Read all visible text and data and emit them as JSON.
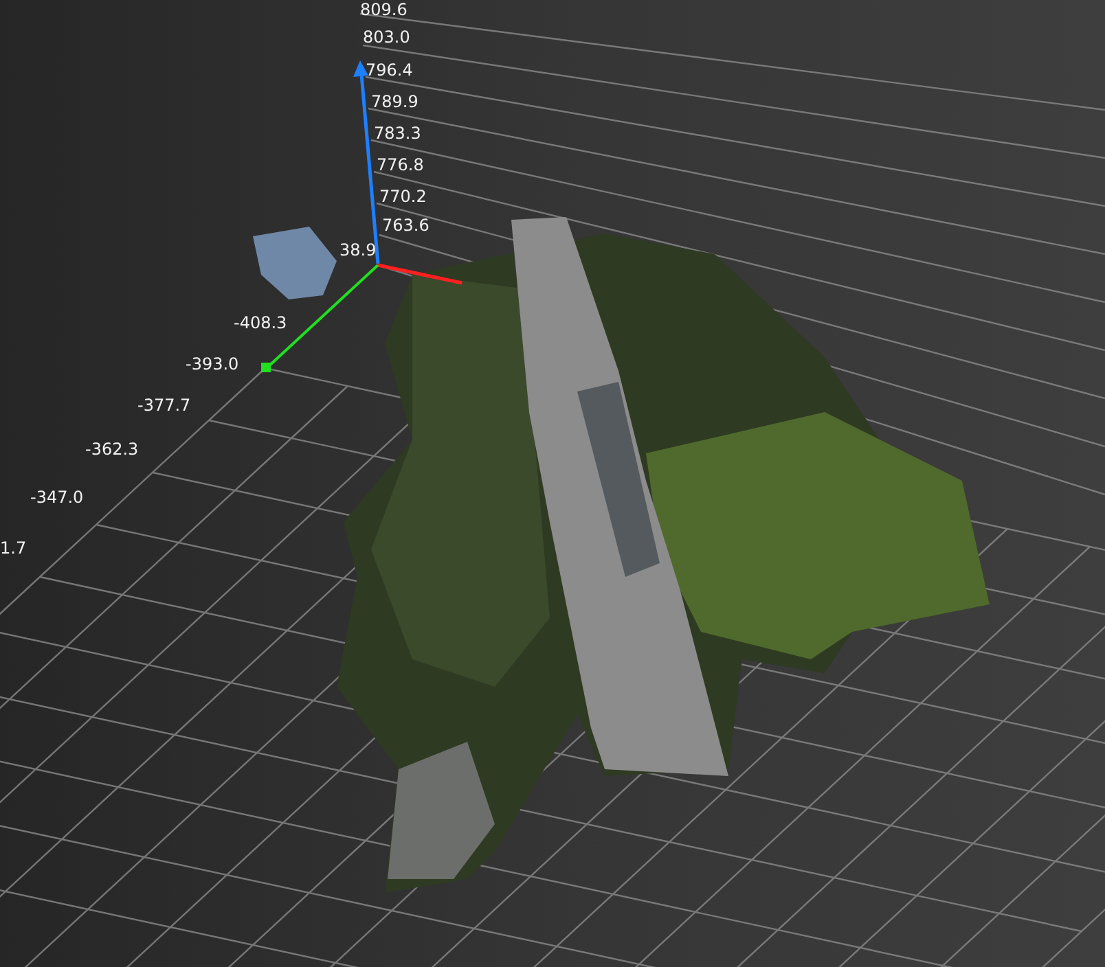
{
  "vertical_axis_labels": [
    "809.6",
    "803.0",
    "796.4",
    "789.9",
    "783.3",
    "776.8",
    "770.2",
    "763.6"
  ],
  "origin_label": "38.9",
  "horizontal_axis_labels": [
    "-408.3",
    "-393.0",
    "-377.7",
    "-362.3",
    "-347.0",
    "1.7"
  ]
}
